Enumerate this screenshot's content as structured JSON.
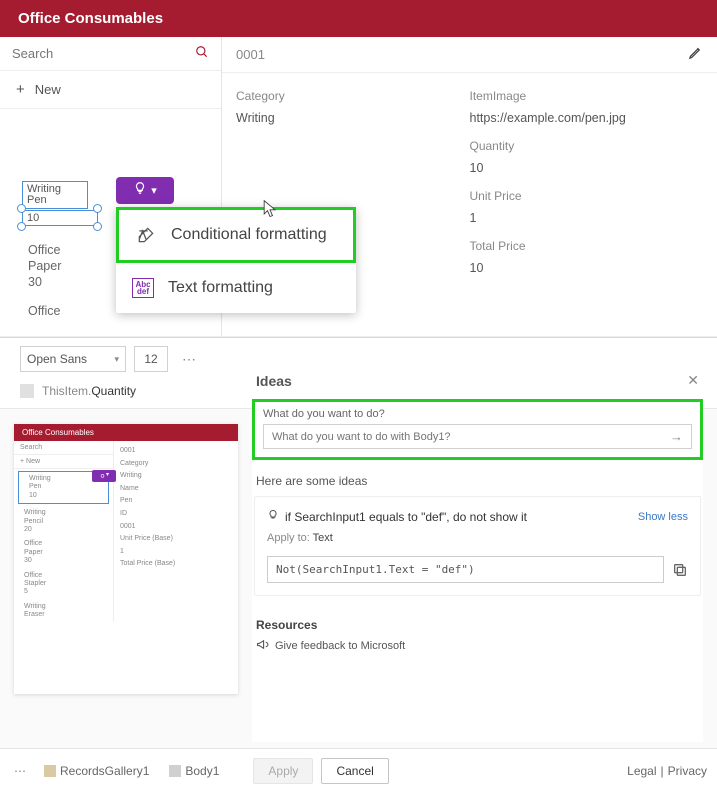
{
  "banner": {
    "title": "Office Consumables"
  },
  "search": {
    "placeholder": "Search"
  },
  "new_btn": {
    "label": "New"
  },
  "gallery": [
    {
      "title": "Writing",
      "sub": "Pen",
      "qty": "10"
    },
    {
      "title": "Writing",
      "sub": "Pencil",
      "qty": "20"
    },
    {
      "title": "Office",
      "sub": "Paper",
      "qty": "30"
    },
    {
      "title": "Office",
      "sub": ""
    }
  ],
  "context_menu": {
    "item1": "Conditional formatting",
    "item2": "Text formatting"
  },
  "id_box": {
    "value": "0001"
  },
  "details": {
    "l_category": "Category",
    "v_category": "Writing",
    "l_image": "ItemImage",
    "v_image": "https://example.com/pen.jpg",
    "l_qty": "Quantity",
    "v_qty": "10",
    "l_unitprice": "Unit Price",
    "v_unitprice": "1",
    "l_upbase": "Unit Price (Base)",
    "v_upbase": "1",
    "l_total": "Total Price",
    "v_total": "10",
    "l_tpbase": "Total Price (Base)"
  },
  "toolbar": {
    "font": "Open Sans",
    "size": "12"
  },
  "formula": {
    "prefix": "ThisItem.",
    "field": "Quantity"
  },
  "mini": {
    "banner": "Office Consumables",
    "search": "Search",
    "new": "+  New",
    "items": [
      {
        "t": "Writing",
        "s": "Pen",
        "q": "10"
      },
      {
        "t": "Writing",
        "s": "Pencil",
        "q": "20"
      },
      {
        "t": "Office",
        "s": "Paper",
        "q": "30"
      },
      {
        "t": "Office",
        "s": "Stapler",
        "q": "5"
      },
      {
        "t": "Writing",
        "s": "Eraser",
        "q": ""
      }
    ],
    "right_id": "0001",
    "r_cat": "Category",
    "r_cat_v": "Writing",
    "r_name": "Name",
    "r_name_v": "Pen",
    "r_id": "ID",
    "r_id_v": "0001",
    "r_up": "Unit Price (Base)",
    "r_up_v": "1",
    "r_tp": "Total Price (Base)"
  },
  "ideas": {
    "title": "Ideas",
    "question_label": "What do you want to do?",
    "input_placeholder": "What do you want to do with Body1?",
    "sub_head": "Here are some ideas",
    "idea1_title": "if SearchInput1 equals to \"def\", do not show it",
    "show_less": "Show less",
    "apply_to": "Apply to:",
    "apply_target": "Text",
    "code": "Not(SearchInput1.Text = \"def\")",
    "resources": "Resources",
    "feedback": "Give feedback to Microsoft"
  },
  "footer": {
    "crumb1": "RecordsGallery1",
    "crumb2": "Body1",
    "apply": "Apply",
    "cancel": "Cancel",
    "legal": "Legal",
    "privacy": "Privacy"
  }
}
